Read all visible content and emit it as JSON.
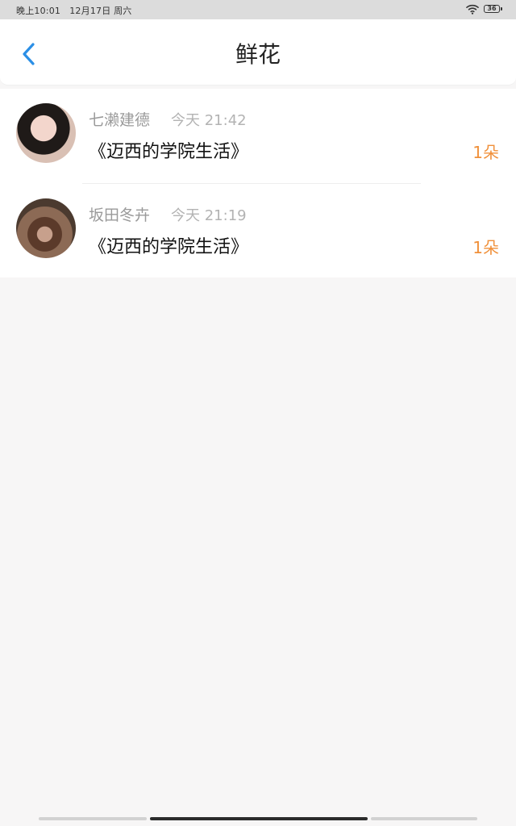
{
  "status_bar": {
    "time": "晚上10:01",
    "date": "12月17日 周六",
    "battery": "36",
    "icons": [
      "wifi-icon",
      "battery-icon"
    ]
  },
  "header": {
    "title": "鲜花",
    "back_icon": "chevron-left-icon"
  },
  "colors": {
    "accent": "#2b8fe6",
    "flower_count": "#f0903a",
    "muted_text": "#9a9a9a"
  },
  "items": [
    {
      "name": "七濑建德",
      "time": "今天 21:42",
      "book": "《迈西的学院生活》",
      "count": "1朵"
    },
    {
      "name": "坂田冬卉",
      "time": "今天 21:19",
      "book": "《迈西的学院生活》",
      "count": "1朵"
    }
  ]
}
